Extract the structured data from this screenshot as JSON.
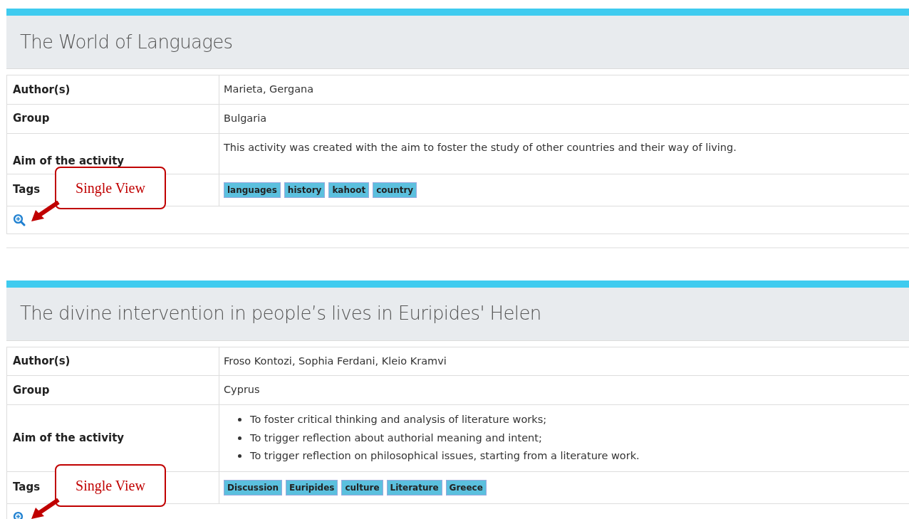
{
  "cards": [
    {
      "title": "The World of Languages",
      "rows": [
        {
          "label": "Author(s)",
          "kind": "text",
          "value": "Marieta, Gergana"
        },
        {
          "label": "Group",
          "kind": "text",
          "value": "Bulgaria"
        },
        {
          "label": "Aim of the activity",
          "kind": "text",
          "value": "This activity was created with the aim to foster the study of other countries and their way of living."
        },
        {
          "label": "Tags",
          "kind": "tags",
          "items": [
            "languages",
            "history",
            "kahoot",
            "country"
          ]
        }
      ],
      "callout": "Single View"
    },
    {
      "title": "The divine intervention in people’s lives in Euripides' Helen",
      "rows": [
        {
          "label": "Author(s)",
          "kind": "text",
          "value": "Froso Kontozi, Sophia Ferdani, Kleio Kramvi"
        },
        {
          "label": "Group",
          "kind": "text",
          "value": "Cyprus"
        },
        {
          "label": "Aim of the activity",
          "kind": "list",
          "items": [
            "To foster critical thinking and analysis of literature works;",
            "To trigger reflection about authorial meaning and intent;",
            "To trigger reflection on philosophical issues, starting from a literature work."
          ]
        },
        {
          "label": "Tags",
          "kind": "tags",
          "items": [
            "Discussion",
            "Euripides",
            "culture",
            "Literature",
            "Greece"
          ]
        }
      ],
      "callout": "Single View"
    }
  ]
}
